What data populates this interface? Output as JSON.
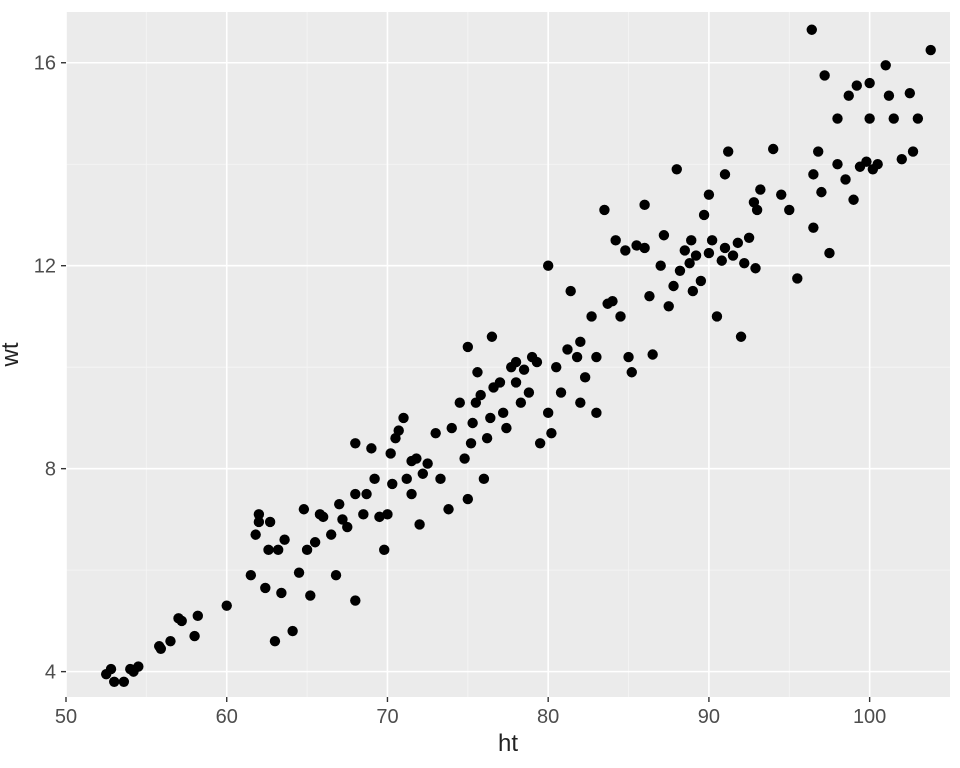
{
  "chart_data": {
    "type": "scatter",
    "xlabel": "ht",
    "ylabel": "wt",
    "xlim": [
      50,
      105
    ],
    "ylim": [
      3.5,
      17
    ],
    "xticks": [
      50,
      60,
      70,
      80,
      90,
      100
    ],
    "yticks": [
      4,
      8,
      12,
      16
    ],
    "grid": true,
    "points": [
      {
        "x": 52.5,
        "y": 3.95
      },
      {
        "x": 52.8,
        "y": 4.05
      },
      {
        "x": 53.0,
        "y": 3.8
      },
      {
        "x": 53.6,
        "y": 3.8
      },
      {
        "x": 54.0,
        "y": 4.05
      },
      {
        "x": 54.2,
        "y": 4.0
      },
      {
        "x": 54.5,
        "y": 4.1
      },
      {
        "x": 55.8,
        "y": 4.5
      },
      {
        "x": 55.9,
        "y": 4.45
      },
      {
        "x": 56.5,
        "y": 4.6
      },
      {
        "x": 57.0,
        "y": 5.05
      },
      {
        "x": 57.2,
        "y": 5.0
      },
      {
        "x": 58.0,
        "y": 4.7
      },
      {
        "x": 58.2,
        "y": 5.1
      },
      {
        "x": 60.0,
        "y": 5.3
      },
      {
        "x": 62.0,
        "y": 7.1
      },
      {
        "x": 61.8,
        "y": 6.7
      },
      {
        "x": 62.0,
        "y": 6.95
      },
      {
        "x": 61.5,
        "y": 5.9
      },
      {
        "x": 62.4,
        "y": 5.65
      },
      {
        "x": 62.6,
        "y": 6.4
      },
      {
        "x": 62.7,
        "y": 6.95
      },
      {
        "x": 63.0,
        "y": 4.6
      },
      {
        "x": 63.2,
        "y": 6.4
      },
      {
        "x": 63.4,
        "y": 5.55
      },
      {
        "x": 63.6,
        "y": 6.6
      },
      {
        "x": 64.1,
        "y": 4.8
      },
      {
        "x": 64.5,
        "y": 5.95
      },
      {
        "x": 64.8,
        "y": 7.2
      },
      {
        "x": 65.0,
        "y": 6.4
      },
      {
        "x": 65.2,
        "y": 5.5
      },
      {
        "x": 65.8,
        "y": 7.1
      },
      {
        "x": 65.5,
        "y": 6.55
      },
      {
        "x": 66.0,
        "y": 7.05
      },
      {
        "x": 66.5,
        "y": 6.7
      },
      {
        "x": 66.8,
        "y": 5.9
      },
      {
        "x": 67.0,
        "y": 7.3
      },
      {
        "x": 67.2,
        "y": 7.0
      },
      {
        "x": 67.5,
        "y": 6.85
      },
      {
        "x": 68.0,
        "y": 8.5
      },
      {
        "x": 68.0,
        "y": 7.5
      },
      {
        "x": 68.0,
        "y": 5.4
      },
      {
        "x": 68.5,
        "y": 7.1
      },
      {
        "x": 68.7,
        "y": 7.5
      },
      {
        "x": 69.0,
        "y": 8.4
      },
      {
        "x": 69.2,
        "y": 7.8
      },
      {
        "x": 69.5,
        "y": 7.05
      },
      {
        "x": 69.8,
        "y": 6.4
      },
      {
        "x": 70.0,
        "y": 7.1
      },
      {
        "x": 70.2,
        "y": 8.3
      },
      {
        "x": 70.3,
        "y": 7.7
      },
      {
        "x": 70.5,
        "y": 8.6
      },
      {
        "x": 70.7,
        "y": 8.75
      },
      {
        "x": 71.0,
        "y": 9.0
      },
      {
        "x": 71.2,
        "y": 7.8
      },
      {
        "x": 71.5,
        "y": 7.5
      },
      {
        "x": 71.8,
        "y": 8.2
      },
      {
        "x": 71.5,
        "y": 8.15
      },
      {
        "x": 72.0,
        "y": 6.9
      },
      {
        "x": 72.2,
        "y": 7.9
      },
      {
        "x": 72.5,
        "y": 8.1
      },
      {
        "x": 73.0,
        "y": 8.7
      },
      {
        "x": 73.3,
        "y": 7.8
      },
      {
        "x": 73.8,
        "y": 7.2
      },
      {
        "x": 74.0,
        "y": 8.8
      },
      {
        "x": 74.5,
        "y": 9.3
      },
      {
        "x": 74.8,
        "y": 8.2
      },
      {
        "x": 75.0,
        "y": 7.4
      },
      {
        "x": 75.0,
        "y": 10.4
      },
      {
        "x": 75.2,
        "y": 8.5
      },
      {
        "x": 75.3,
        "y": 8.9
      },
      {
        "x": 75.5,
        "y": 9.3
      },
      {
        "x": 75.6,
        "y": 9.9
      },
      {
        "x": 75.8,
        "y": 9.45
      },
      {
        "x": 76.0,
        "y": 7.8
      },
      {
        "x": 76.2,
        "y": 8.6
      },
      {
        "x": 76.4,
        "y": 9.0
      },
      {
        "x": 76.5,
        "y": 10.6
      },
      {
        "x": 76.6,
        "y": 9.6
      },
      {
        "x": 77.0,
        "y": 9.7
      },
      {
        "x": 77.2,
        "y": 9.1
      },
      {
        "x": 77.4,
        "y": 8.8
      },
      {
        "x": 77.7,
        "y": 10.0
      },
      {
        "x": 78.0,
        "y": 10.1
      },
      {
        "x": 78.0,
        "y": 9.7
      },
      {
        "x": 78.3,
        "y": 9.3
      },
      {
        "x": 78.5,
        "y": 9.95
      },
      {
        "x": 78.8,
        "y": 9.5
      },
      {
        "x": 79.0,
        "y": 10.2
      },
      {
        "x": 79.3,
        "y": 10.1
      },
      {
        "x": 79.5,
        "y": 8.5
      },
      {
        "x": 80.0,
        "y": 9.1
      },
      {
        "x": 80.0,
        "y": 12.0
      },
      {
        "x": 80.2,
        "y": 8.7
      },
      {
        "x": 80.5,
        "y": 10.0
      },
      {
        "x": 80.8,
        "y": 9.5
      },
      {
        "x": 81.2,
        "y": 10.35
      },
      {
        "x": 81.4,
        "y": 11.5
      },
      {
        "x": 81.8,
        "y": 10.2
      },
      {
        "x": 82.0,
        "y": 10.5
      },
      {
        "x": 82.0,
        "y": 9.3
      },
      {
        "x": 82.3,
        "y": 9.8
      },
      {
        "x": 82.7,
        "y": 11.0
      },
      {
        "x": 83.0,
        "y": 9.1
      },
      {
        "x": 83.0,
        "y": 10.2
      },
      {
        "x": 83.5,
        "y": 13.1
      },
      {
        "x": 83.7,
        "y": 11.25
      },
      {
        "x": 84.0,
        "y": 11.3
      },
      {
        "x": 84.2,
        "y": 12.5
      },
      {
        "x": 84.5,
        "y": 11.0
      },
      {
        "x": 84.8,
        "y": 12.3
      },
      {
        "x": 85.0,
        "y": 10.2
      },
      {
        "x": 85.2,
        "y": 9.9
      },
      {
        "x": 85.5,
        "y": 12.4
      },
      {
        "x": 86.0,
        "y": 12.35
      },
      {
        "x": 86.0,
        "y": 13.2
      },
      {
        "x": 86.3,
        "y": 11.4
      },
      {
        "x": 86.5,
        "y": 10.25
      },
      {
        "x": 87.0,
        "y": 12.0
      },
      {
        "x": 87.2,
        "y": 12.6
      },
      {
        "x": 87.5,
        "y": 11.2
      },
      {
        "x": 87.8,
        "y": 11.6
      },
      {
        "x": 88.0,
        "y": 13.9
      },
      {
        "x": 88.2,
        "y": 11.9
      },
      {
        "x": 88.5,
        "y": 12.3
      },
      {
        "x": 88.8,
        "y": 12.05
      },
      {
        "x": 88.9,
        "y": 12.5
      },
      {
        "x": 89.0,
        "y": 11.5
      },
      {
        "x": 89.2,
        "y": 12.2
      },
      {
        "x": 89.5,
        "y": 11.7
      },
      {
        "x": 89.7,
        "y": 13.0
      },
      {
        "x": 90.0,
        "y": 12.25
      },
      {
        "x": 90.0,
        "y": 13.4
      },
      {
        "x": 90.2,
        "y": 12.5
      },
      {
        "x": 90.5,
        "y": 11.0
      },
      {
        "x": 90.8,
        "y": 12.1
      },
      {
        "x": 91.0,
        "y": 13.8
      },
      {
        "x": 91.0,
        "y": 12.35
      },
      {
        "x": 91.2,
        "y": 14.25
      },
      {
        "x": 91.5,
        "y": 12.2
      },
      {
        "x": 91.8,
        "y": 12.45
      },
      {
        "x": 92.0,
        "y": 10.6
      },
      {
        "x": 92.2,
        "y": 12.05
      },
      {
        "x": 92.5,
        "y": 12.55
      },
      {
        "x": 92.9,
        "y": 11.95
      },
      {
        "x": 92.8,
        "y": 13.25
      },
      {
        "x": 93.0,
        "y": 13.1
      },
      {
        "x": 93.2,
        "y": 13.5
      },
      {
        "x": 94.0,
        "y": 14.3
      },
      {
        "x": 94.5,
        "y": 13.4
      },
      {
        "x": 95.0,
        "y": 13.1
      },
      {
        "x": 95.5,
        "y": 11.75
      },
      {
        "x": 96.4,
        "y": 16.65
      },
      {
        "x": 96.5,
        "y": 13.8
      },
      {
        "x": 96.5,
        "y": 12.75
      },
      {
        "x": 96.8,
        "y": 14.25
      },
      {
        "x": 97.0,
        "y": 13.45
      },
      {
        "x": 97.2,
        "y": 15.75
      },
      {
        "x": 97.5,
        "y": 12.25
      },
      {
        "x": 98.0,
        "y": 14.9
      },
      {
        "x": 98.0,
        "y": 14.0
      },
      {
        "x": 98.5,
        "y": 13.7
      },
      {
        "x": 98.7,
        "y": 15.35
      },
      {
        "x": 99.0,
        "y": 13.3
      },
      {
        "x": 99.2,
        "y": 15.55
      },
      {
        "x": 99.4,
        "y": 13.95
      },
      {
        "x": 99.8,
        "y": 14.05
      },
      {
        "x": 100.0,
        "y": 14.9
      },
      {
        "x": 100.0,
        "y": 15.6
      },
      {
        "x": 100.2,
        "y": 13.9
      },
      {
        "x": 100.5,
        "y": 14.0
      },
      {
        "x": 101.0,
        "y": 15.95
      },
      {
        "x": 101.2,
        "y": 15.35
      },
      {
        "x": 101.5,
        "y": 14.9
      },
      {
        "x": 102.0,
        "y": 14.1
      },
      {
        "x": 102.5,
        "y": 15.4
      },
      {
        "x": 102.7,
        "y": 14.25
      },
      {
        "x": 103.0,
        "y": 14.9
      },
      {
        "x": 103.8,
        "y": 16.25
      }
    ]
  }
}
